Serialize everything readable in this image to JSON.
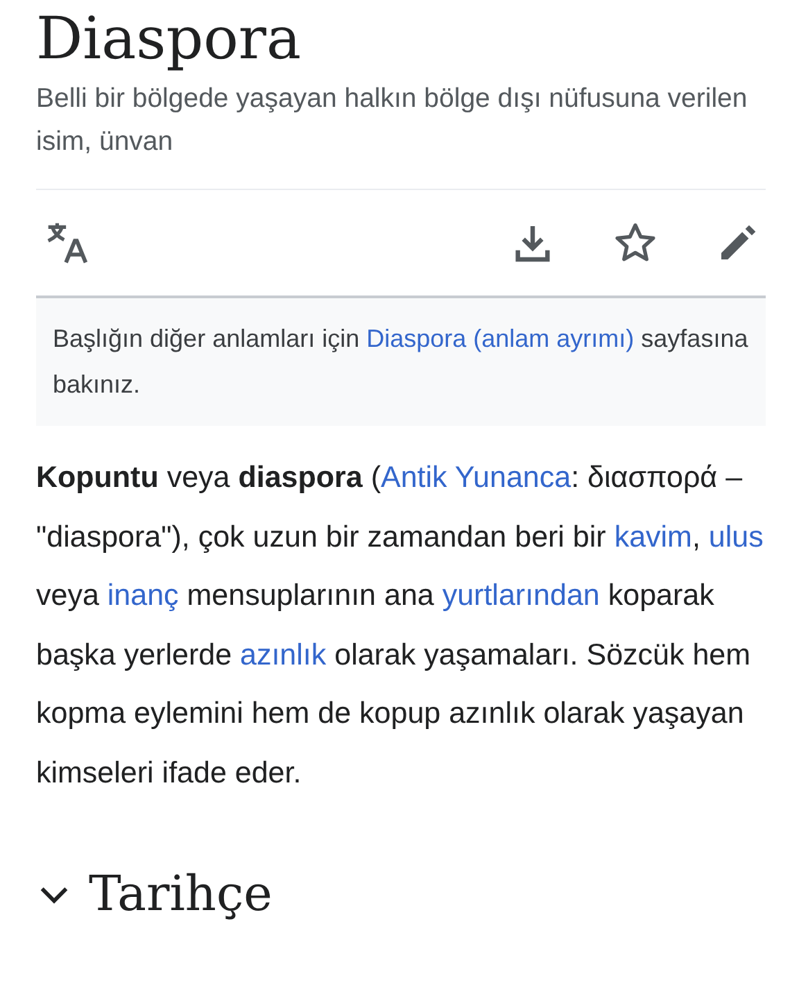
{
  "title": "Diaspora",
  "description": "Belli bir bölgede yaşayan halkın bölge dışı nüfusuna verilen isim, ünvan",
  "toolbar": [
    {
      "kind": "language"
    },
    {
      "kind": "download"
    },
    {
      "kind": "watch",
      "selected": false
    },
    {
      "kind": "edit"
    }
  ],
  "hatnote": [
    {
      "kind": "text",
      "text": "Başlığın diğer anlamları için "
    },
    {
      "kind": "link",
      "text": "Diaspora (anlam ayrımı)"
    },
    {
      "kind": "text",
      "text": " sayfasına bakınız."
    }
  ],
  "paragraph": [
    {
      "kind": "bold",
      "text": "Kopuntu"
    },
    {
      "kind": "text",
      "text": " veya "
    },
    {
      "kind": "bold",
      "text": "diaspora"
    },
    {
      "kind": "text",
      "text": " ("
    },
    {
      "kind": "link",
      "text": "Antik Yunanca"
    },
    {
      "kind": "text",
      "text": ": διασπορά – \"diaspora\"), çok uzun bir zamandan beri bir "
    },
    {
      "kind": "link",
      "text": "kavim"
    },
    {
      "kind": "text",
      "text": ", "
    },
    {
      "kind": "link",
      "text": "ulus"
    },
    {
      "kind": "text",
      "text": " veya "
    },
    {
      "kind": "link",
      "text": "inanç"
    },
    {
      "kind": "text",
      "text": " mensuplarının ana "
    },
    {
      "kind": "link",
      "text": "yurtlarından"
    },
    {
      "kind": "text",
      "text": " koparak başka yerlerde "
    },
    {
      "kind": "link",
      "text": "azınlık"
    },
    {
      "kind": "text",
      "text": " olarak yaşamaları. Sözcük hem kopma eylemini hem de kopup azınlık olarak yaşayan kimseleri ifade eder."
    }
  ],
  "section": {
    "title": "Tarihçe",
    "expanded": false
  }
}
